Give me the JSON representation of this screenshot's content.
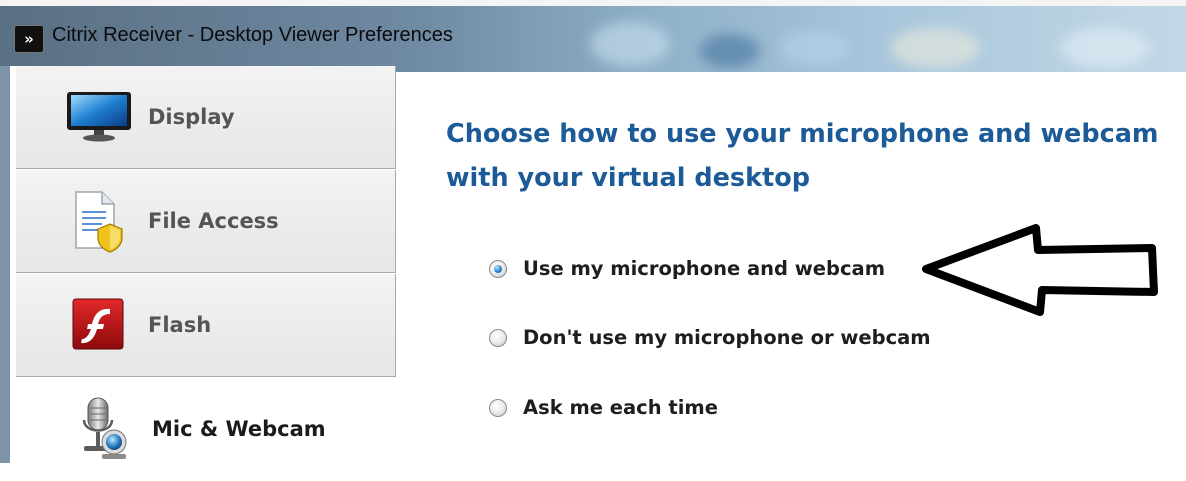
{
  "window": {
    "title": "Citrix Receiver - Desktop Viewer Preferences",
    "icon": "citrix-receiver-icon"
  },
  "sidebar": {
    "items": [
      {
        "label": "Display",
        "icon": "monitor-icon",
        "selected": false
      },
      {
        "label": "File Access",
        "icon": "file-shield-icon",
        "selected": false
      },
      {
        "label": "Flash",
        "icon": "flash-icon",
        "selected": false
      },
      {
        "label": "Mic & Webcam",
        "icon": "microphone-webcam-icon",
        "selected": true
      }
    ]
  },
  "main": {
    "heading": "Choose how to use your microphone and webcam with your virtual desktop",
    "options": [
      {
        "label": "Use my microphone and webcam",
        "selected": true
      },
      {
        "label": "Don't use my microphone or webcam",
        "selected": false
      },
      {
        "label": "Ask me each time",
        "selected": false
      }
    ]
  },
  "annotation": {
    "type": "arrow",
    "direction": "left",
    "color": "#000000"
  },
  "colors": {
    "heading": "#1d5a98",
    "accent": "#2f86c9"
  }
}
